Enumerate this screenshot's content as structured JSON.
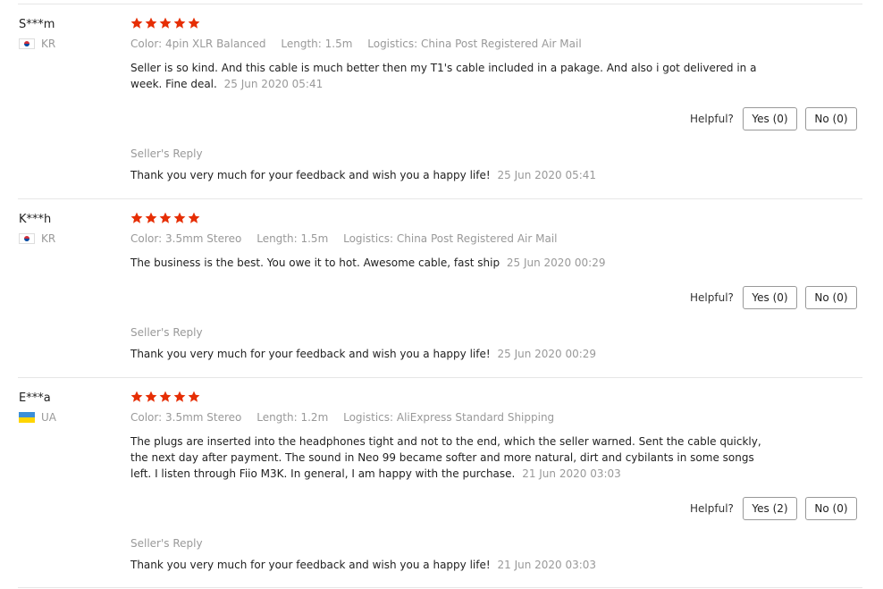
{
  "labels": {
    "color": "Color:",
    "length": "Length:",
    "logistics": "Logistics:",
    "helpful": "Helpful?",
    "seller_reply": "Seller's Reply"
  },
  "colors": {
    "star": "#e62e04",
    "accent_muted": "#999999"
  },
  "reviews": [
    {
      "name": "S***m",
      "country": "KR",
      "flag_icon": "south-korea-flag-icon",
      "stars": 5,
      "color": "4pin XLR Balanced",
      "length": "1.5m",
      "logistics": "China Post Registered Air Mail",
      "text": "Seller is so kind. And this cable is much better then my T1's cable included in a pakage. And also i got delivered in a week. Fine deal.",
      "date": "25 Jun 2020 05:41",
      "yes": "Yes (0)",
      "no": "No (0)",
      "reply": "Thank you very much for your feedback and wish you a happy life!",
      "reply_date": "25 Jun 2020 05:41"
    },
    {
      "name": "K***h",
      "country": "KR",
      "flag_icon": "south-korea-flag-icon",
      "stars": 5,
      "color": "3.5mm Stereo",
      "length": "1.5m",
      "logistics": "China Post Registered Air Mail",
      "text": "The business is the best. You owe it to hot. Awesome cable, fast ship",
      "date": "25 Jun 2020 00:29",
      "yes": "Yes (0)",
      "no": "No (0)",
      "reply": "Thank you very much for your feedback and wish you a happy life!",
      "reply_date": "25 Jun 2020 00:29"
    },
    {
      "name": "E***a",
      "country": "UA",
      "flag_icon": "ukraine-flag-icon",
      "stars": 5,
      "color": "3.5mm Stereo",
      "length": "1.2m",
      "logistics": "AliExpress Standard Shipping",
      "text": "The plugs are inserted into the headphones tight and not to the end, which the seller warned. Sent the cable quickly, the next day after payment. The sound in Neo 99 became softer and more natural, dirt and cybilants in some songs left. I listen through Fiio M3K. In general, I am happy with the purchase.",
      "date": "21 Jun 2020 03:03",
      "yes": "Yes (2)",
      "no": "No (0)",
      "reply": "Thank you very much for your feedback and wish you a happy life!",
      "reply_date": "21 Jun 2020 03:03"
    }
  ]
}
